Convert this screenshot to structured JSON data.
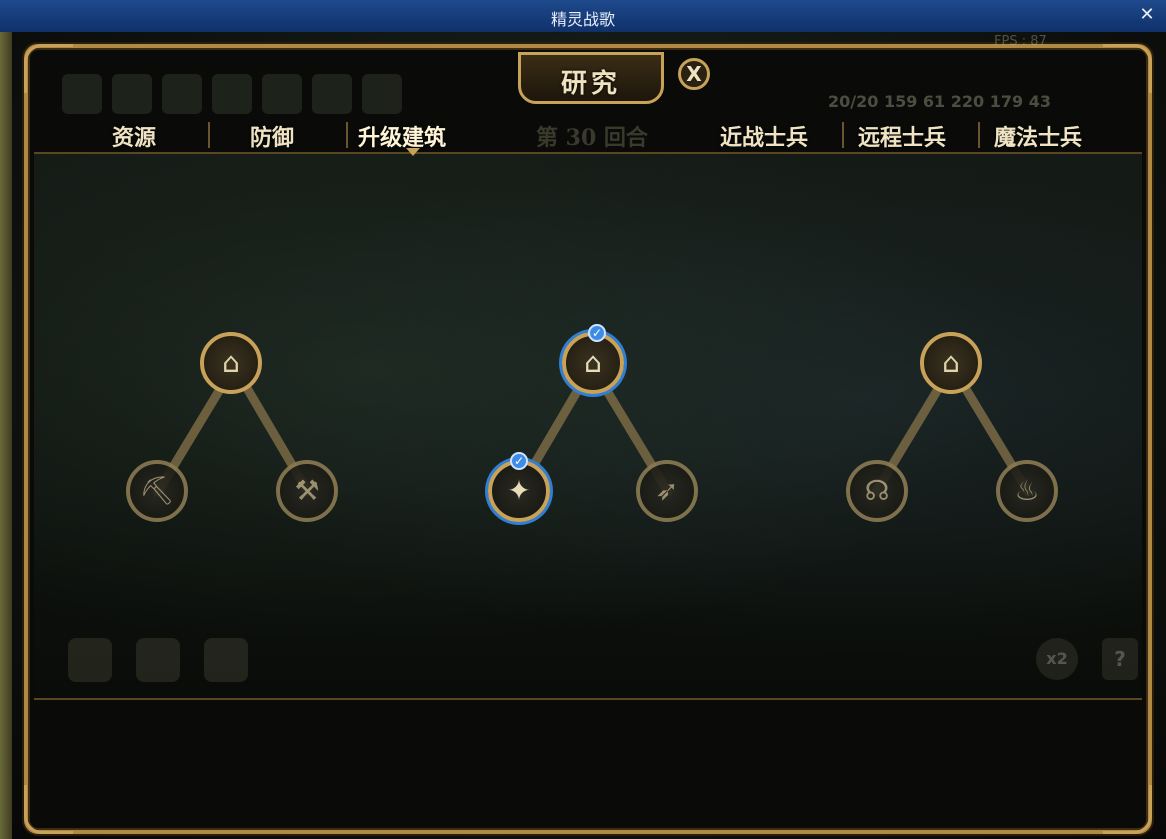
{
  "window": {
    "title": "精灵战歌",
    "close_glyph": "✕"
  },
  "panel": {
    "title": "研究",
    "close_glyph": "X"
  },
  "hud": {
    "fps": "FPS : 87",
    "resources": "20/20  159  61   220  179  43"
  },
  "tabs": {
    "resources": "资源",
    "defense": "防御",
    "upgrade_buildings": "升级建筑",
    "round": "第 30 回合",
    "melee": "近战士兵",
    "ranged": "远程士兵",
    "magic": "魔法士兵"
  },
  "bottom": {
    "speed": "x2",
    "help": "?"
  },
  "colors": {
    "gold": "#c9a25a",
    "completed": "#3d8de8"
  },
  "nodes": {
    "tree1_root": {
      "icon": "house-upgrade-icon",
      "state": "available"
    },
    "tree1_left": {
      "icon": "shield-pickaxe-icon",
      "state": "locked"
    },
    "tree1_right": {
      "icon": "hammer-pick-icon",
      "state": "locked"
    },
    "tree2_root": {
      "icon": "house-bow-upgrade-icon",
      "state": "researched"
    },
    "tree2_left": {
      "icon": "spear-sparkle-icon",
      "state": "researched"
    },
    "tree2_right": {
      "icon": "bow-arrow-icon",
      "state": "locked"
    },
    "tree3_root": {
      "icon": "house-magic-upgrade-icon",
      "state": "available"
    },
    "tree3_left": {
      "icon": "halo-book-icon",
      "state": "locked"
    },
    "tree3_right": {
      "icon": "fire-book-icon",
      "state": "locked"
    }
  }
}
